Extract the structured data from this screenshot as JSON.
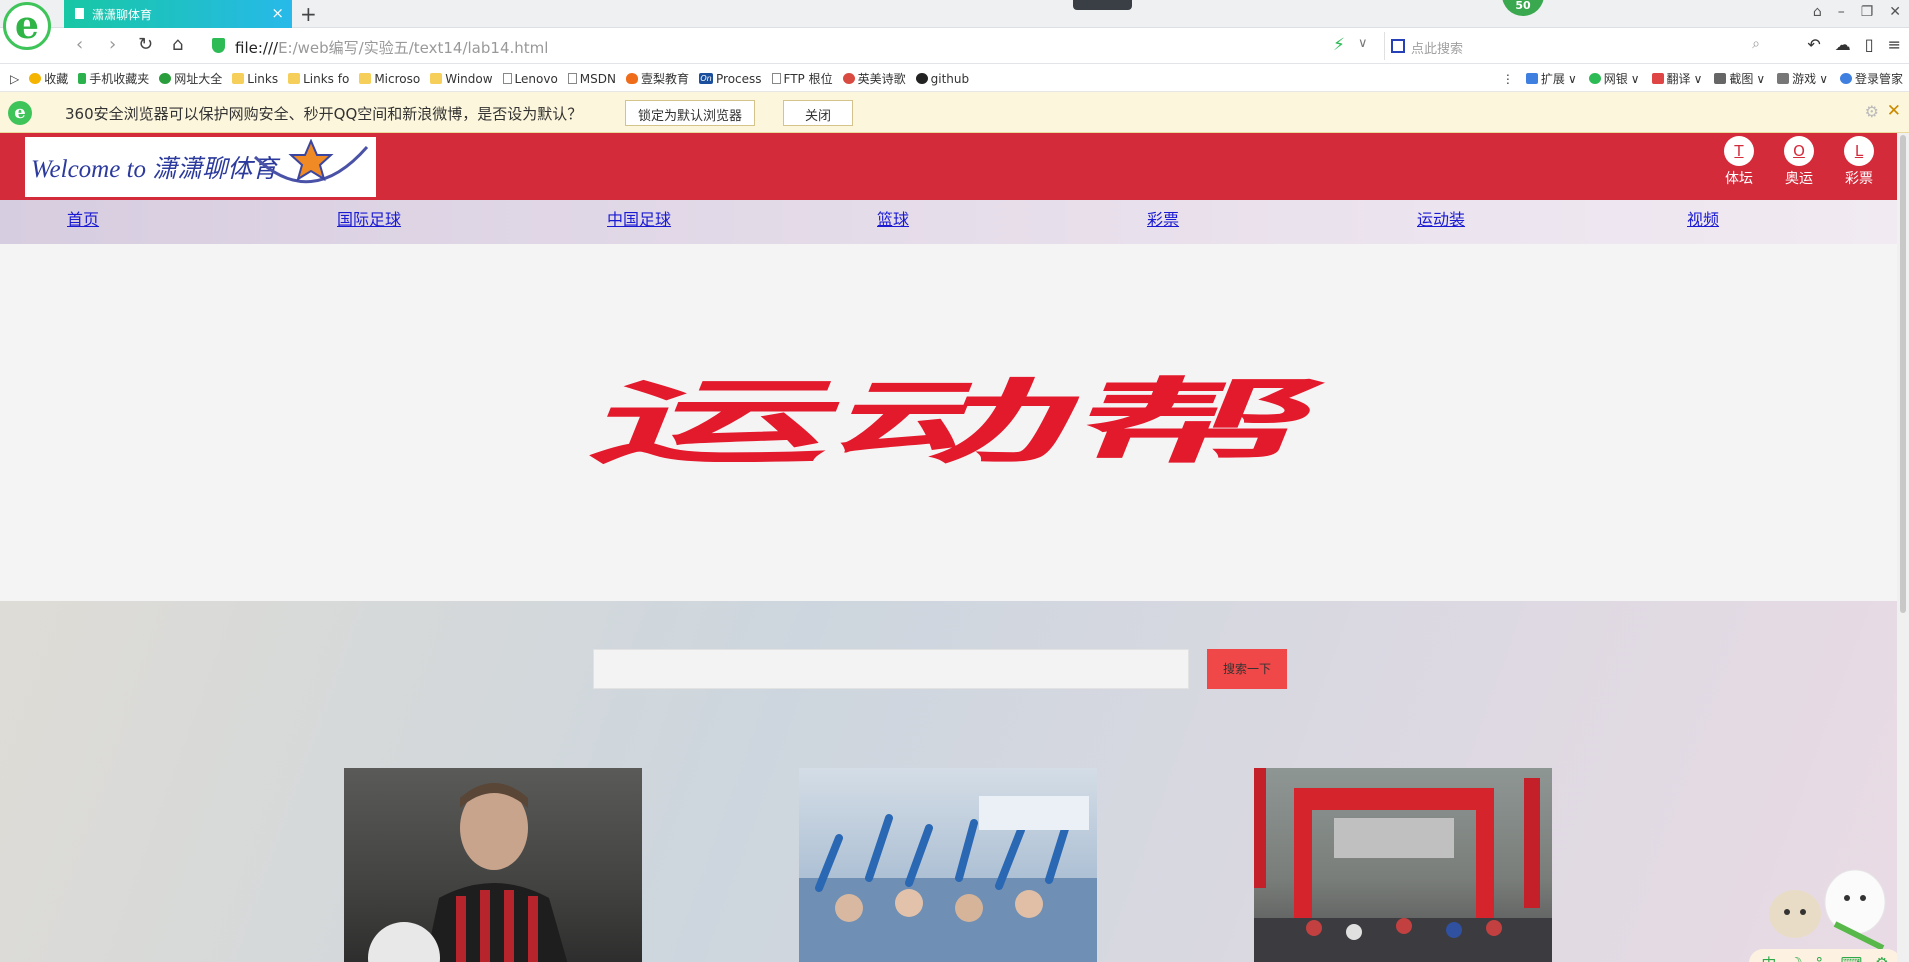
{
  "browser": {
    "tab_title": "潇潇聊体育",
    "tab_close": "×",
    "new_tab": "+",
    "score": "50",
    "url_scheme": "file:///",
    "url_path": "E:/web编写/实验五/text14/lab14.html",
    "search_placeholder": "点此搜索",
    "brand_color": "#3fc45a",
    "tab_gradient": [
      "#18c7a4",
      "#27b9e9"
    ]
  },
  "bookmarks": [
    {
      "label": "收藏",
      "icon": "star-icon"
    },
    {
      "label": "手机收藏夹",
      "icon": "phone-icon"
    },
    {
      "label": "网址大全",
      "icon": "globe-icon"
    },
    {
      "label": "Links",
      "icon": "folder-icon"
    },
    {
      "label": "Links fo",
      "icon": "folder-icon"
    },
    {
      "label": "Microso",
      "icon": "folder-icon"
    },
    {
      "label": "Window",
      "icon": "folder-icon"
    },
    {
      "label": "Lenovo",
      "icon": "page-icon"
    },
    {
      "label": "MSDN",
      "icon": "page-icon"
    },
    {
      "label": "壹梨教育",
      "icon": "fire-icon"
    },
    {
      "label": "Process",
      "icon": "on-icon"
    },
    {
      "label": "FTP 根位",
      "icon": "page-icon"
    },
    {
      "label": "英美诗歌",
      "icon": "flower-icon"
    },
    {
      "label": "github",
      "icon": "github-icon"
    }
  ],
  "bookmark_tools": [
    {
      "label": "扩展",
      "icon": "extension-icon"
    },
    {
      "label": "网银",
      "icon": "bank-icon"
    },
    {
      "label": "翻译",
      "icon": "translate-icon"
    },
    {
      "label": "截图",
      "icon": "screenshot-icon"
    },
    {
      "label": "游戏",
      "icon": "game-icon"
    },
    {
      "label": "登录管家",
      "icon": "login-icon"
    }
  ],
  "infobar": {
    "message": "360安全浏览器可以保护网购安全、秒开QQ空间和新浪微博，是否设为默认？",
    "set_default_label": "锁定为默认浏览器",
    "close_label": "关闭"
  },
  "site": {
    "logo_text": "Welcome to 潇潇聊体育",
    "header_color": "#d42b3b",
    "quick_links": [
      {
        "letter": "T",
        "label": "体坛"
      },
      {
        "letter": "O",
        "label": "奥运"
      },
      {
        "letter": "L",
        "label": "彩票"
      }
    ],
    "nav": [
      "首页",
      "国际足球",
      "中国足球",
      "篮球",
      "彩票",
      "运动装",
      "视频"
    ],
    "banner_text": "运动帮",
    "banner_color": "#e3192c",
    "search_button": "搜索一下",
    "search_button_color": "#f04848"
  },
  "ime": {
    "mode": "中"
  }
}
